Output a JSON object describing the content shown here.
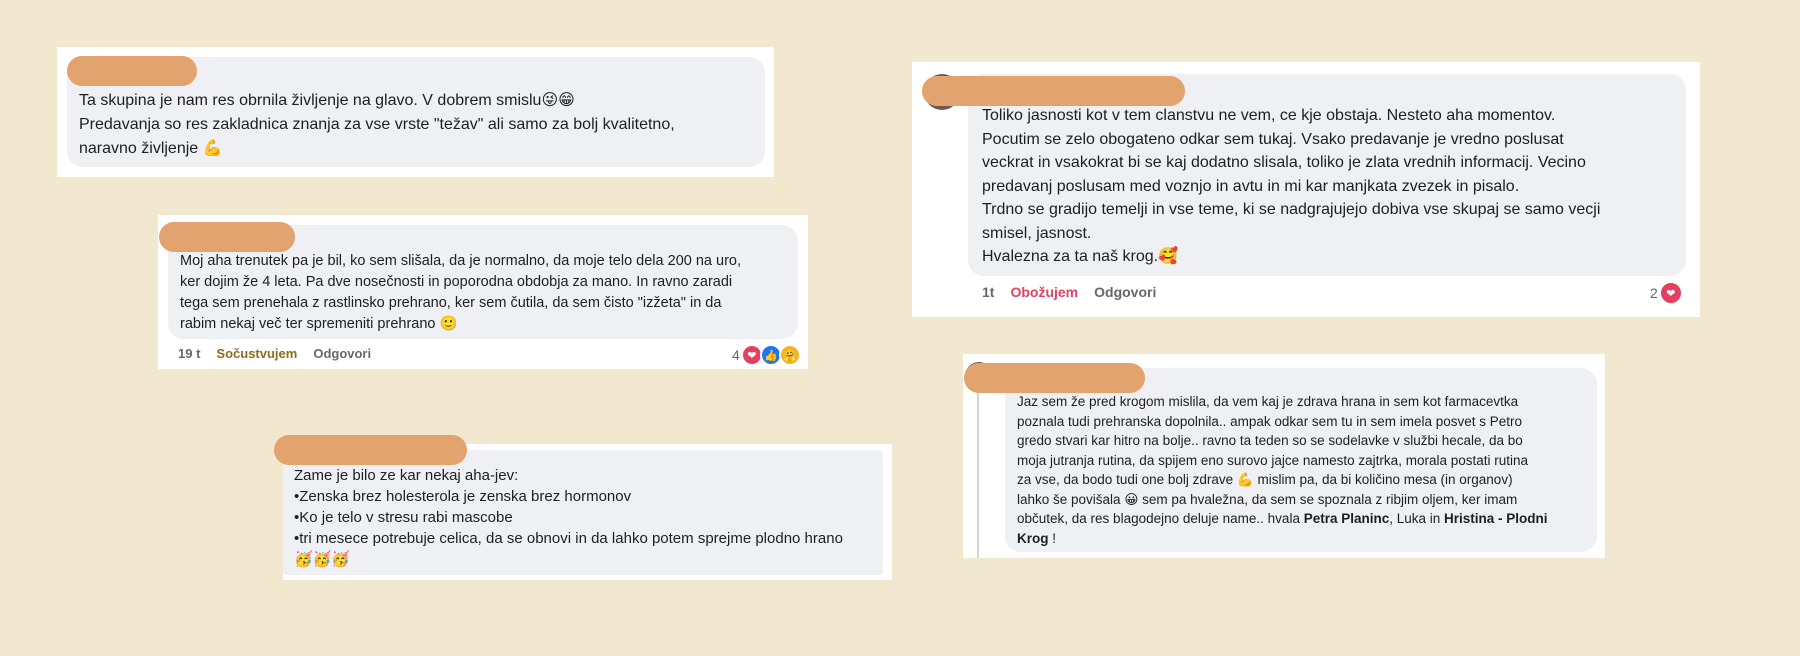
{
  "comments": [
    {
      "lines": [
        "Ta skupina je nam res obrnila življenje na glavo. V dobrem smislu😜😁",
        "Predavanja so res zakladnica znanja za vse vrste \"težav\" ali samo za bolj kvalitetno,",
        "naravno življenje 💪"
      ]
    },
    {
      "lines": [
        "Moj aha trenutek pa je bil, ko sem slišala, da je normalno, da moje telo dela 200 na uro,",
        "ker dojim že 4 leta. Pa dve nosečnosti in poporodna obdobja za mano. In ravno zaradi",
        "tega sem prenehala z rastlinsko prehrano, ker sem čutila, da sem čisto \"izžeta\" in da",
        "rabim nekaj več ter spremeniti prehrano 🙂"
      ],
      "time": "19 t",
      "reaction_label": "Sočustvujem",
      "reply_label": "Odgovori",
      "reaction_count": "4",
      "reaction_icons": [
        "heart-react-icon",
        "like-react-icon",
        "care-react-icon"
      ]
    },
    {
      "lines": [
        "Zame je bilo ze kar nekaj aha-jev:",
        "•Zenska brez holesterola je zenska brez hormonov",
        "•Ko je telo v stresu rabi mascobe",
        "•tri mesece potrebuje celica, da se obnovi in da lahko potem sprejme plodno hrano",
        "🥳🥳🥳"
      ]
    },
    {
      "lines": [
        "Toliko jasnosti kot v tem clanstvu ne vem, ce kje obstaja. Nesteto aha momentov.",
        "Pocutim se zelo obogateno odkar sem tukaj. Vsako predavanje je vredno poslusat",
        "veckrat in vsakokrat bi se kaj dodatno slisala, toliko je zlata vrednih informacij. Vecino",
        "predavanj poslusam med voznjo in avtu in mi kar manjkata zvezek in pisalo.",
        "Trdno se gradijo temelji in vse teme, ki se nadgrajujejo dobiva vse skupaj se samo vecji",
        "smisel, jasnost.",
        "Hvalezna za ta naš krog.🥰"
      ],
      "time": "1t",
      "reaction_label": "Obožujem",
      "reply_label": "Odgovori",
      "reaction_count": "2",
      "reaction_icons": [
        "heart-react-icon"
      ]
    },
    {
      "lines": [
        "Jaz sem že pred krogom mislila, da vem kaj je zdrava hrana in sem kot farmacevtka",
        "poznala tudi prehranska dopolnila.. ampak odkar sem tu in sem imela posvet s Petro",
        "gredo stvari kar hitro na bolje.. ravno ta teden so se sodelavke v službi hecale, da bo",
        "moja jutranja rutina, da spijem eno surovo jajce namesto zajtrka, morala postati rutina",
        "za vse, da bodo tudi one bolj zdrave 💪 mislim pa, da bi količino mesa (in organov)",
        "lahko še povišala 😀 sem pa hvaležna, da sem se spoznala z ribjim oljem, ker imam",
        "občutek, da res blagodejno deluje name.. hvala "
      ],
      "mention_1": "Petra Planinc",
      "mid_text": ", Luka in ",
      "mention_2": "Hristina - Plodni",
      "mention_2b": "Krog",
      "end_text": " !"
    }
  ],
  "colors": {
    "background": "#f1e8cf",
    "name_redaction": "#e2a36e",
    "bubble": "#eef0f3",
    "care_reaction": "#8a6d1e",
    "love_reaction": "#e4405f"
  }
}
